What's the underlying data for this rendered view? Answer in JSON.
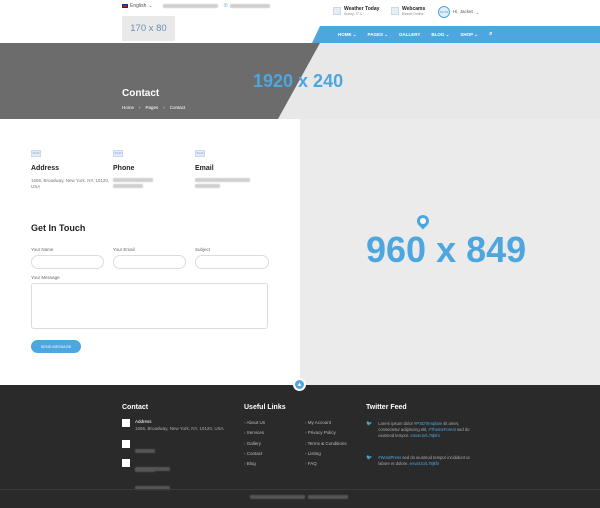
{
  "topbar": {
    "language": "English",
    "logo_placeholder": "170 x 80"
  },
  "header": {
    "weather_title": "Weather Today",
    "weather_sub": "Sunny, 3° C",
    "webcams_title": "Webcams",
    "webcams_sub": "Resort Online",
    "greeting": "Hi, Jacket"
  },
  "nav": {
    "items": [
      "HOME",
      "PAGES",
      "GALLERY",
      "BLOG",
      "SHOP"
    ]
  },
  "banner": {
    "size_label": "1920 x 240",
    "title": "Contact",
    "breadcrumb": [
      "Home",
      "Pages",
      "Contact"
    ]
  },
  "contact": {
    "address_heading": "Address",
    "address_text": "1556, Broadway, New York, NY, 10120, USA",
    "phone_heading": "Phone",
    "email_heading": "Email",
    "icon_label": "50x40"
  },
  "form": {
    "heading": "Get In Touch",
    "name_label": "Your Name",
    "email_label": "Your Email",
    "subject_label": "Subject",
    "message_label": "Your Message",
    "button": "SEND MESSAGE"
  },
  "map": {
    "size_label": "960 x 849"
  },
  "footer": {
    "contact_heading": "Contact",
    "address_label": "Address",
    "address_text": "1556, Broadway, New York, NY, 10120, USA",
    "links_heading": "Useful Links",
    "links_col1": [
      "About Us",
      "Services",
      "Gallery",
      "Contact",
      "Blog"
    ],
    "links_col2": [
      "My Account",
      "Privacy Policy",
      "Terms & Conditions",
      "Listing",
      "FAQ"
    ],
    "twitter_heading": "Twitter Feed",
    "tweet1_pre": "Lorem ipsum dolor ",
    "tweet1_tag1": "#PSDTemplate",
    "tweet1_mid": " sit amet, consectetur adipiscing elit, ",
    "tweet1_tag2": "#ThemeForest",
    "tweet1_post": " sed do eiusmod tempor. ",
    "tweet1_link": "envat.to/L78jkhi",
    "tweet2_tag": "#WordPress",
    "tweet2_mid": " sed do eiusmod tempor incididunt ut labore et dolore. ",
    "tweet2_link": "envat.to/L78jkhi"
  },
  "colors": {
    "accent": "#4ea6df",
    "footer": "#2a2a2a",
    "banner_dark": "#6c6c6c"
  }
}
